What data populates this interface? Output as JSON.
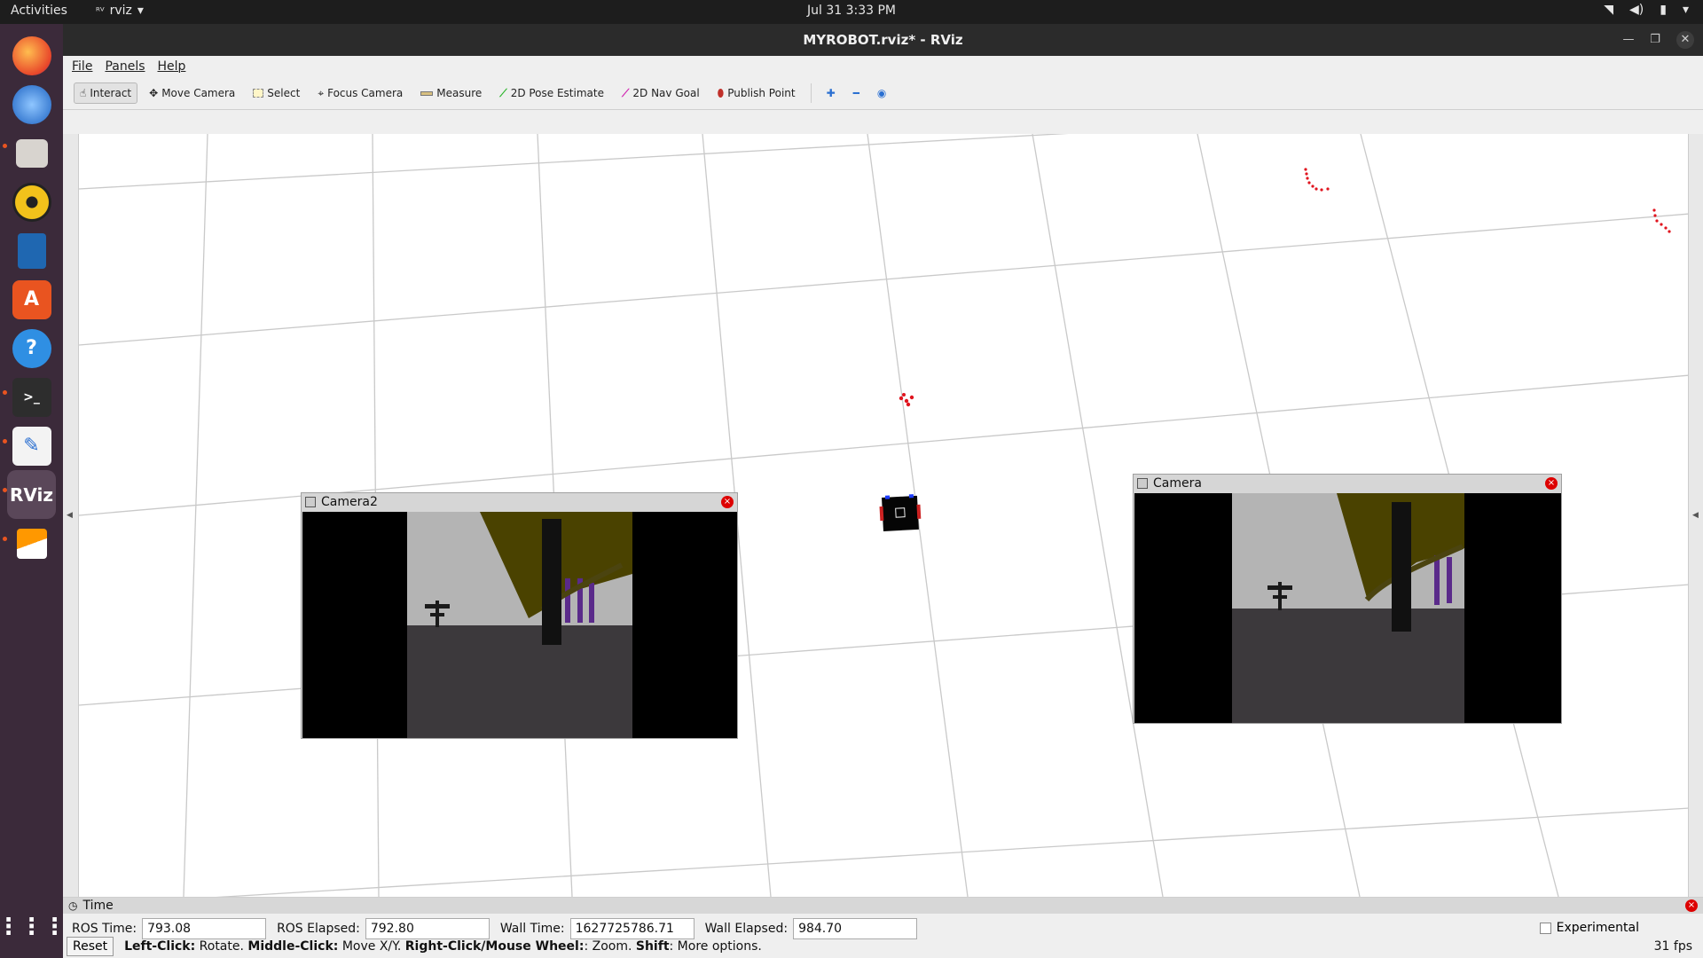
{
  "topbar": {
    "activities": "Activities",
    "app_name": "rviz",
    "clock": "Jul 31  3:33 PM"
  },
  "window": {
    "title": "MYROBOT.rviz* - RViz",
    "menu": [
      "File",
      "Panels",
      "Help"
    ]
  },
  "toolbar": {
    "tools": [
      {
        "label": "Interact",
        "icon": "hand-icon",
        "active": true
      },
      {
        "label": "Move Camera",
        "icon": "move-icon"
      },
      {
        "label": "Select",
        "icon": "select-box-icon"
      },
      {
        "label": "Focus Camera",
        "icon": "crosshair-icon"
      },
      {
        "label": "Measure",
        "icon": "ruler-icon"
      },
      {
        "label": "2D Pose Estimate",
        "icon": "pose-arrow-icon"
      },
      {
        "label": "2D Nav Goal",
        "icon": "nav-arrow-icon"
      },
      {
        "label": "Publish Point",
        "icon": "map-pin-icon"
      }
    ]
  },
  "panels": {
    "camera2_title": "Camera2",
    "camera_title": "Camera"
  },
  "time_panel": {
    "title": "Time",
    "ros_time_label": "ROS Time:",
    "ros_time": "793.08",
    "ros_elapsed_label": "ROS Elapsed:",
    "ros_elapsed": "792.80",
    "wall_time_label": "Wall Time:",
    "wall_time": "1627725786.71",
    "wall_elapsed_label": "Wall Elapsed:",
    "wall_elapsed": "984.70",
    "experimental": "Experimental"
  },
  "status": {
    "reset": "Reset",
    "left_click": "Left-Click:",
    "left_click_desc": "Rotate.",
    "middle_click": "Middle-Click:",
    "middle_click_desc": "Move X/Y.",
    "right_click": "Right-Click/Mouse Wheel:",
    "right_click_desc": ": Zoom.",
    "shift": "Shift",
    "shift_desc": ": More options.",
    "fps": "31 fps"
  },
  "colors": {
    "accent": "#e95420",
    "laser": "#e0141e",
    "robot": "#000000"
  }
}
